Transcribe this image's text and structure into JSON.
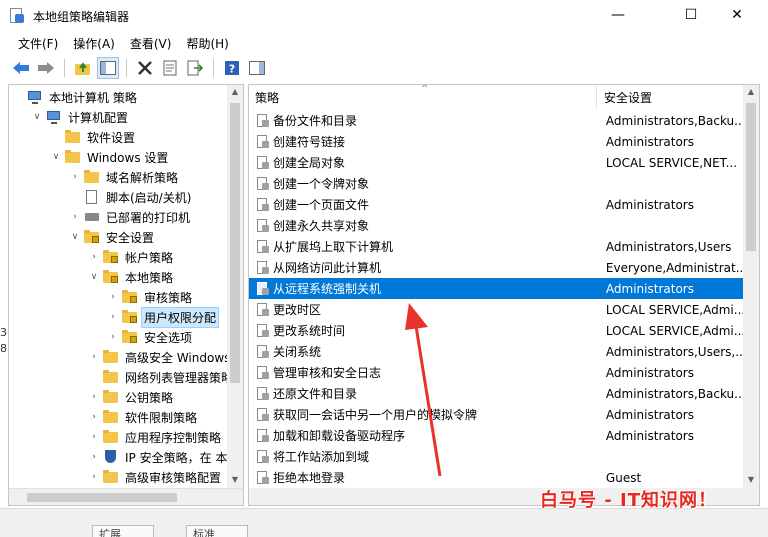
{
  "window": {
    "title": "本地组策略编辑器",
    "minimize": "—",
    "maximize": "☐",
    "close": "✕"
  },
  "menu": [
    "文件(F)",
    "操作(A)",
    "查看(V)",
    "帮助(H)"
  ],
  "tree": [
    {
      "label": "本地计算机 策略",
      "icon": "computer-icon",
      "indent": 0,
      "expander": ""
    },
    {
      "label": "计算机配置",
      "icon": "computer-icon",
      "indent": 1,
      "expander": "∨"
    },
    {
      "label": "软件设置",
      "icon": "folder-icon",
      "indent": 2,
      "expander": ""
    },
    {
      "label": "Windows 设置",
      "icon": "folder-icon",
      "indent": 2,
      "expander": "∨"
    },
    {
      "label": "域名解析策略",
      "icon": "folder-icon",
      "indent": 3,
      "expander": "›"
    },
    {
      "label": "脚本(启动/关机)",
      "icon": "script-icon",
      "indent": 3,
      "expander": ""
    },
    {
      "label": "已部署的打印机",
      "icon": "printer-icon",
      "indent": 3,
      "expander": "›"
    },
    {
      "label": "安全设置",
      "icon": "lock-folder-icon",
      "indent": 3,
      "expander": "∨"
    },
    {
      "label": "帐户策略",
      "icon": "lock-folder-icon",
      "indent": 4,
      "expander": "›"
    },
    {
      "label": "本地策略",
      "icon": "lock-folder-icon",
      "indent": 4,
      "expander": "∨"
    },
    {
      "label": "审核策略",
      "icon": "lock-folder-icon",
      "indent": 5,
      "expander": "›"
    },
    {
      "label": "用户权限分配",
      "icon": "lock-folder-icon",
      "indent": 5,
      "expander": "›",
      "selected": true
    },
    {
      "label": "安全选项",
      "icon": "lock-folder-icon",
      "indent": 5,
      "expander": "›"
    },
    {
      "label": "高级安全 Windows D",
      "icon": "folder-icon",
      "indent": 4,
      "expander": "›"
    },
    {
      "label": "网络列表管理器策略",
      "icon": "folder-icon",
      "indent": 4,
      "expander": ""
    },
    {
      "label": "公钥策略",
      "icon": "folder-icon",
      "indent": 4,
      "expander": "›"
    },
    {
      "label": "软件限制策略",
      "icon": "folder-icon",
      "indent": 4,
      "expander": "›"
    },
    {
      "label": "应用程序控制策略",
      "icon": "folder-icon",
      "indent": 4,
      "expander": "›"
    },
    {
      "label": "IP 安全策略，在 本地",
      "icon": "shield-icon",
      "indent": 4,
      "expander": "›"
    },
    {
      "label": "高级审核策略配置",
      "icon": "folder-icon",
      "indent": 4,
      "expander": "›"
    }
  ],
  "list": {
    "col_policy": "策略",
    "col_setting": "安全设置",
    "sort_indicator": "^",
    "rows": [
      {
        "name": "备份文件和目录",
        "setting": "Administrators,Backu..."
      },
      {
        "name": "创建符号链接",
        "setting": "Administrators"
      },
      {
        "name": "创建全局对象",
        "setting": "LOCAL SERVICE,NET..."
      },
      {
        "name": "创建一个令牌对象",
        "setting": ""
      },
      {
        "name": "创建一个页面文件",
        "setting": "Administrators"
      },
      {
        "name": "创建永久共享对象",
        "setting": ""
      },
      {
        "name": "从扩展坞上取下计算机",
        "setting": "Administrators,Users"
      },
      {
        "name": "从网络访问此计算机",
        "setting": "Everyone,Administrat..."
      },
      {
        "name": "从远程系统强制关机",
        "setting": "Administrators",
        "selected": true
      },
      {
        "name": "更改时区",
        "setting": "LOCAL SERVICE,Admi..."
      },
      {
        "name": "更改系统时间",
        "setting": "LOCAL SERVICE,Admi..."
      },
      {
        "name": "关闭系统",
        "setting": "Administrators,Users,..."
      },
      {
        "name": "管理审核和安全日志",
        "setting": "Administrators"
      },
      {
        "name": "还原文件和目录",
        "setting": "Administrators,Backu..."
      },
      {
        "name": "获取同一会话中另一个用户的模拟令牌",
        "setting": "Administrators"
      },
      {
        "name": "加载和卸载设备驱动程序",
        "setting": "Administrators"
      },
      {
        "name": "将工作站添加到域",
        "setting": ""
      },
      {
        "name": "拒绝本地登录",
        "setting": "Guest"
      }
    ]
  },
  "bottom_tabs": [
    "扩展",
    "标准"
  ],
  "watermark": "白马号 - IT知识网！",
  "edge_digits": [
    "3",
    "8"
  ],
  "colors": {
    "selection": "#0078d7",
    "tree_selection": "#cce8ff",
    "annotation_arrow": "#e8322a"
  }
}
